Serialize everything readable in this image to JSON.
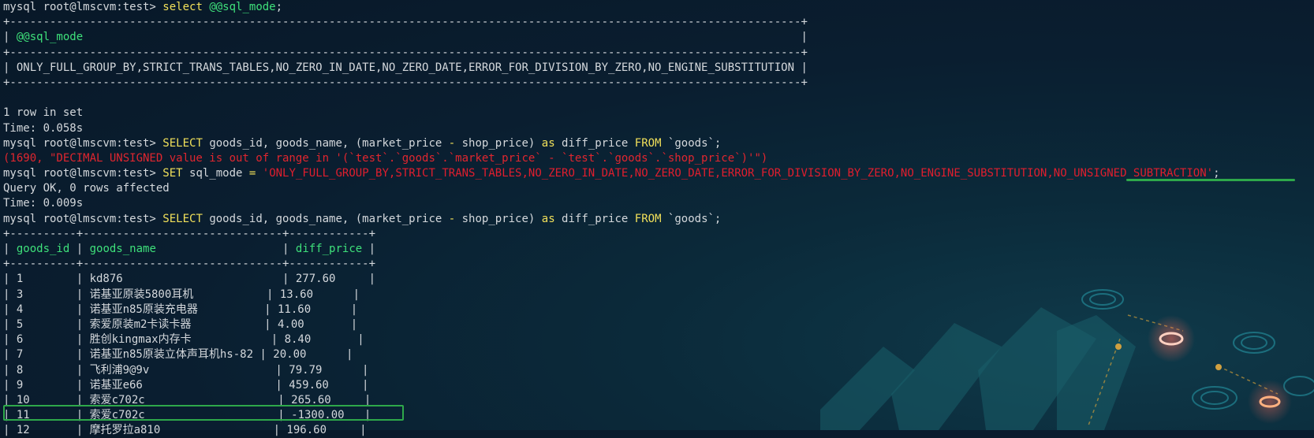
{
  "lines": [
    {
      "t": "prompt",
      "prompt": "mysql root@lmscvm:test>",
      "cmd": [
        {
          "c": "kw",
          "v": " select "
        },
        {
          "c": "hdr",
          "v": "@@sql_mode"
        },
        {
          "c": "ident",
          "v": ";"
        }
      ]
    },
    {
      "t": "raw",
      "v": "+-----------------------------------------------------------------------------------------------------------------------+"
    },
    {
      "t": "hdrrow",
      "cells": [
        {
          "c": "ident",
          "v": "| "
        },
        {
          "c": "hdr",
          "v": "@@sql_mode"
        },
        {
          "c": "ident",
          "v": "                                                                                                            |"
        }
      ]
    },
    {
      "t": "raw",
      "v": "+-----------------------------------------------------------------------------------------------------------------------+"
    },
    {
      "t": "raw",
      "v": "| ONLY_FULL_GROUP_BY,STRICT_TRANS_TABLES,NO_ZERO_IN_DATE,NO_ZERO_DATE,ERROR_FOR_DIVISION_BY_ZERO,NO_ENGINE_SUBSTITUTION |"
    },
    {
      "t": "raw",
      "v": "+-----------------------------------------------------------------------------------------------------------------------+"
    },
    {
      "t": "raw",
      "v": ""
    },
    {
      "t": "raw",
      "v": "1 row in set"
    },
    {
      "t": "raw",
      "v": "Time: 0.058s"
    },
    {
      "t": "prompt",
      "prompt": "mysql root@lmscvm:test>",
      "cmd": [
        {
          "c": "kw",
          "v": " SELECT "
        },
        {
          "c": "ident",
          "v": "goods_id, goods_name, (market_price "
        },
        {
          "c": "op",
          "v": "-"
        },
        {
          "c": "ident",
          "v": " shop_price) "
        },
        {
          "c": "kw",
          "v": "as"
        },
        {
          "c": "ident",
          "v": " diff_price "
        },
        {
          "c": "kw",
          "v": "FROM"
        },
        {
          "c": "ident",
          "v": " `goods`;"
        }
      ]
    },
    {
      "t": "err",
      "v": "(1690, \"DECIMAL UNSIGNED value is out of range in '(`test`.`goods`.`market_price` - `test`.`goods`.`shop_price`)'\")"
    },
    {
      "t": "prompt",
      "prompt": "mysql root@lmscvm:test>",
      "cmd": [
        {
          "c": "kw",
          "v": " SET "
        },
        {
          "c": "ident",
          "v": "sql_mode "
        },
        {
          "c": "op",
          "v": "="
        },
        {
          "c": "ident",
          "v": " "
        },
        {
          "c": "str",
          "v": "'ONLY_FULL_GROUP_BY,STRICT_TRANS_TABLES,NO_ZERO_IN_DATE,NO_ZERO_DATE,ERROR_FOR_DIVISION_BY_ZERO,NO_ENGINE_SUBSTITUTION,NO_UNSIGNED_SUBTRACTION'"
        },
        {
          "c": "ident",
          "v": ";"
        }
      ]
    },
    {
      "t": "raw",
      "v": "Query OK, 0 rows affected"
    },
    {
      "t": "raw",
      "v": "Time: 0.009s"
    },
    {
      "t": "prompt",
      "prompt": "mysql root@lmscvm:test>",
      "cmd": [
        {
          "c": "kw",
          "v": " SELECT "
        },
        {
          "c": "ident",
          "v": "goods_id, goods_name, (market_price "
        },
        {
          "c": "op",
          "v": "-"
        },
        {
          "c": "ident",
          "v": " shop_price) "
        },
        {
          "c": "kw",
          "v": "as"
        },
        {
          "c": "ident",
          "v": " diff_price "
        },
        {
          "c": "kw",
          "v": "FROM"
        },
        {
          "c": "ident",
          "v": " `goods`;"
        }
      ]
    },
    {
      "t": "raw",
      "v": "+----------+------------------------------+------------+"
    },
    {
      "t": "hdrrow",
      "cells": [
        {
          "c": "ident",
          "v": "| "
        },
        {
          "c": "hdr",
          "v": "goods_id"
        },
        {
          "c": "ident",
          "v": " | "
        },
        {
          "c": "hdr",
          "v": "goods_name"
        },
        {
          "c": "ident",
          "v": "                   | "
        },
        {
          "c": "hdr",
          "v": "diff_price"
        },
        {
          "c": "ident",
          "v": " |"
        }
      ]
    },
    {
      "t": "raw",
      "v": "+----------+------------------------------+------------+"
    },
    {
      "t": "raw",
      "v": "| 1        | kd876                        | 277.60     |"
    },
    {
      "t": "raw",
      "v": "| 3        | 诺基亚原装5800耳机           | 13.60      |"
    },
    {
      "t": "raw",
      "v": "| 4        | 诺基亚n85原装充电器          | 11.60      |"
    },
    {
      "t": "raw",
      "v": "| 5        | 索爱原装m2卡读卡器           | 4.00       |"
    },
    {
      "t": "raw",
      "v": "| 6        | 胜创kingmax内存卡            | 8.40       |"
    },
    {
      "t": "raw",
      "v": "| 7        | 诺基亚n85原装立体声耳机hs-82 | 20.00      |"
    },
    {
      "t": "raw",
      "v": "| 8        | 飞利浦9@9v                   | 79.79      |"
    },
    {
      "t": "raw",
      "v": "| 9        | 诺基亚e66                    | 459.60     |"
    },
    {
      "t": "raw",
      "v": "| 10       | 索爱c702c                    | 265.60     |"
    },
    {
      "t": "raw",
      "v": "| 11       | 索爱c702c                    | -1300.00   |"
    },
    {
      "t": "raw",
      "v": "| 12       | 摩托罗拉a810                 | 196.60     |"
    }
  ]
}
